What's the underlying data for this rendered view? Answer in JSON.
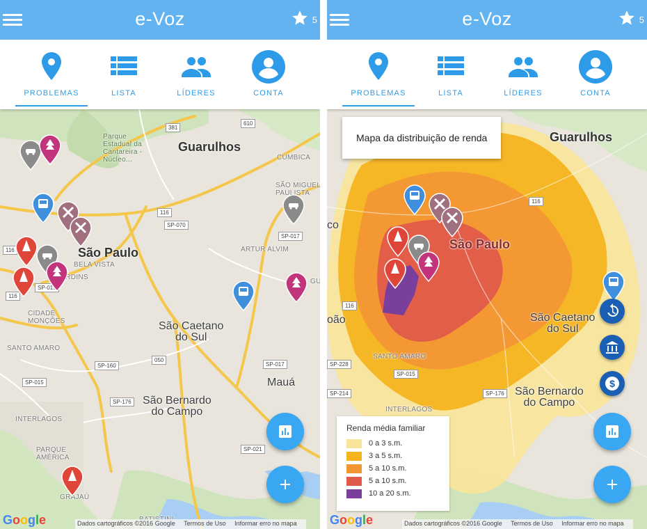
{
  "app": {
    "title": "e-Voz",
    "star_count": "5"
  },
  "tabs": [
    {
      "label": "PROBLEMAS",
      "icon": "map-pin-icon"
    },
    {
      "label": "LISTA",
      "icon": "list-icon"
    },
    {
      "label": "LÍDERES",
      "icon": "people-icon"
    },
    {
      "label": "CONTA",
      "icon": "account-circle-icon"
    }
  ],
  "map_labels": {
    "guarulhos": "Guarulhos",
    "sao_paulo": "São Paulo",
    "sao_caetano": "São Caetano\ndo Sul",
    "sao_bernardo": "São Bernardo\ndo Campo",
    "maua": "Mauá",
    "parque": "Parque\nEstadual da\nCantareira -\nNúcleo...",
    "cumbica": "CUMBICA",
    "sao_miguel": "SÃO MIGUEL\nPAULISTA",
    "artur_alvim": "ARTUR ALVIM",
    "bela_vista": "BELA VISTA",
    "jardins": "JARDINS",
    "cidade_moncoes": "CIDADE\nMONÇÕES",
    "santo_amaro": "SANTO AMARO",
    "interlagos": "INTERLAGOS",
    "parque_america": "PARQUE\nAMÉRICA",
    "grajau": "GRAJAÚ",
    "batistini": "BATISTINI",
    "co": "co",
    "joao": "oão",
    "gu": "GU",
    "sp070": "SP-070",
    "sp015": "SP-015",
    "sp017": "SP-017",
    "sp160": "SP-160",
    "sp176": "SP-176",
    "sp021": "SP-021",
    "sp228": "SP-228",
    "sp214": "SP-214",
    "r381": "381",
    "r610": "610",
    "r116": "116",
    "r050": "050",
    "r116b": "116"
  },
  "footer": {
    "brand": [
      "G",
      "o",
      "o",
      "g",
      "l",
      "e"
    ],
    "data": "Dados cartográficos ©2016 Google",
    "terms": "Termos de Uso",
    "report": "Informar erro no mapa"
  },
  "right": {
    "tooltip": "Mapa da distribuição de renda",
    "legend": {
      "title": "Renda média familiar",
      "items": [
        {
          "label": "0 a 3 s.m.",
          "color": "#f8e59a"
        },
        {
          "label": "3 a 5 s.m.",
          "color": "#f5b31c"
        },
        {
          "label": "5 a 10 s.m.",
          "color": "#f29634"
        },
        {
          "label": "5 a 10 s.m.",
          "color": "#e05a4a"
        },
        {
          "label": "10 a 20 s.m.",
          "color": "#7a3f9c"
        }
      ]
    }
  },
  "colors": {
    "appbar": "#62b3ef",
    "accent": "#2e9be8",
    "pin_gray": "#8a8a8a",
    "pin_blue": "#3f8fdc",
    "pin_pink": "#c2357c",
    "pin_mauve": "#a0707e",
    "pin_red": "#e0453a"
  }
}
